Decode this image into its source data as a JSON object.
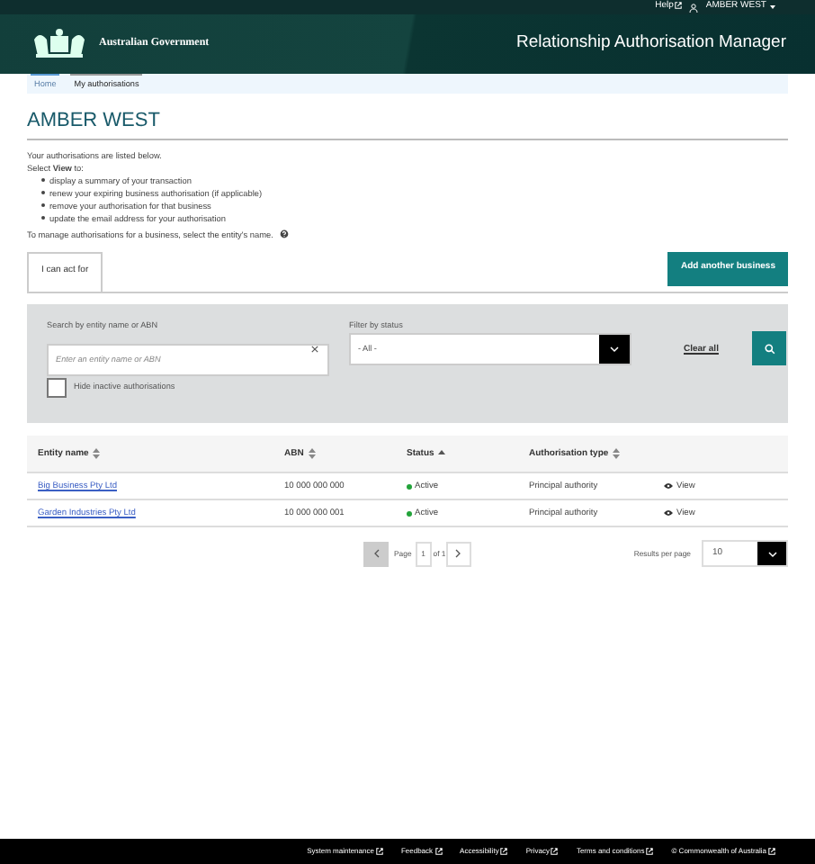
{
  "top_bar": {
    "help": "Help",
    "user": "AMBER WEST"
  },
  "header": {
    "agency": "Australian Government",
    "title": "Relationship Authorisation Manager"
  },
  "breadcrumb": [
    {
      "label": "Home",
      "selected": false
    },
    {
      "label": "My authorisations",
      "selected": true
    }
  ],
  "page_title": "AMBER WEST",
  "intro": {
    "line_1": "Your authorisations are listed below.",
    "line_2": "Select **View** to:",
    "bullets": [
      "display a summary of your transaction",
      "renew your expiring business authorisation (if applicable)",
      "remove your authorisation for that business",
      "update the email address for your authorisation"
    ],
    "note": "To manage authorisations for a business, select the entity's name."
  },
  "tabs": [
    {
      "label": "I can act for",
      "selected": true
    }
  ],
  "add_button": "Add another business",
  "filters": {
    "search_label": "Search by entity name or ABN",
    "search_placeholder": "Enter an entity name or ABN",
    "status_label": "Filter by status",
    "status_value": "- All -",
    "clear": "Clear all",
    "hide_inactive": {
      "label": "Hide inactive authorisations",
      "checked": false
    }
  },
  "table": {
    "columns": [
      {
        "label": "Entity name",
        "sorted": false
      },
      {
        "label": "ABN",
        "sorted": false
      },
      {
        "label": "Status",
        "sorted": true
      },
      {
        "label": "Authorisation type",
        "sorted": false
      }
    ],
    "rows": [
      {
        "entity": "Big Business Pty Ltd",
        "abn": "10 000 000 000",
        "status": "Active",
        "color": "#22a33a",
        "type": "Principal authority",
        "action": "View"
      },
      {
        "entity": "Garden Industries Pty Ltd",
        "abn": "10 000 000 001",
        "status": "Active",
        "color": "#22a33a",
        "type": "Principal authority",
        "action": "View"
      }
    ]
  },
  "pagination": {
    "page_label": "Page",
    "page": "1",
    "of": "of 1",
    "prev_disabled": true,
    "per_page_label": "Results per page",
    "per_page": "10"
  },
  "footer": [
    "System maintenance",
    "Feedback",
    "Accessibility",
    "Privacy",
    "Terms and conditions",
    "© Commonwealth of Australia"
  ]
}
